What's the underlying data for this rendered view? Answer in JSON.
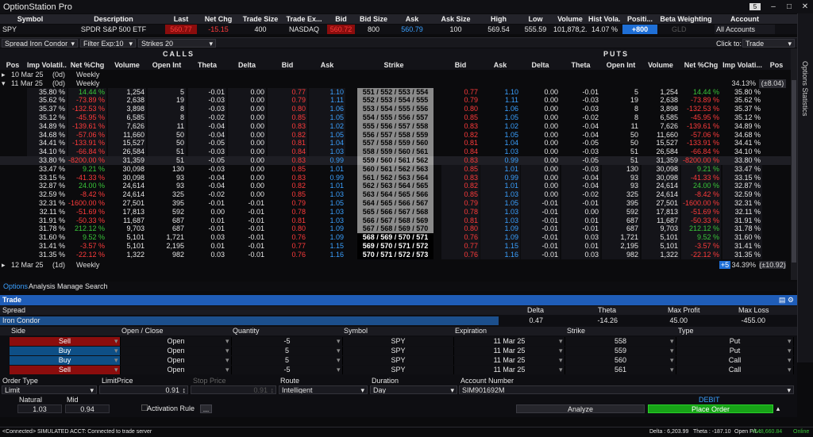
{
  "app": {
    "title": "OptionStation Pro",
    "notification_count": "5"
  },
  "quote": {
    "headers": [
      "Symbol",
      "Description",
      "Last",
      "Net Chg",
      "Trade Size",
      "Trade Ex...",
      "Bid",
      "Bid Size",
      "Ask",
      "Ask Size",
      "High",
      "Low",
      "Volume",
      "Hist Vola...",
      "Positi...",
      "Beta Weighting",
      "Account"
    ],
    "row": {
      "symbol": "SPY",
      "description": "SPDR S&P 500 ETF",
      "last": "560.77",
      "net_chg": "-15.15",
      "trade_size": "400",
      "trade_ex": "NASDAQ",
      "bid": "560.72",
      "bid_size": "800",
      "ask": "560.79",
      "ask_size": "100",
      "high": "569.54",
      "low": "555.59",
      "volume": "101,878,2...",
      "hist_vol": "14.07 %",
      "position": "+800",
      "beta": "GLD",
      "account": "All Accounts"
    }
  },
  "side_tab": "Options Statistics",
  "toolbar": {
    "spread_label": "Spread",
    "spread_value": "Iron Condor",
    "filter_label": "Filter",
    "filter_value": "Exp:10",
    "strikes_label": "Strikes",
    "strikes_value": "20",
    "click_to_label": "Click to:",
    "click_to_value": "Trade"
  },
  "chain": {
    "calls_label": "CALLS",
    "puts_label": "PUTS",
    "call_headers": [
      "Pos",
      "Imp Volatil...",
      "Net %Chg",
      "Volume",
      "Open Int",
      "Theta",
      "Delta",
      "Bid",
      "Ask"
    ],
    "strike_header": "Strike",
    "put_headers": [
      "Bid",
      "Ask",
      "Delta",
      "Theta",
      "Open Int",
      "Volume",
      "Net %Chg",
      "Imp Volati...",
      "Pos"
    ],
    "expiry_groups": [
      {
        "label": "10 Mar 25",
        "dte": "(0d)",
        "type": "Weekly"
      },
      {
        "label": "11 Mar 25",
        "dte": "(0d)",
        "type": "Weekly",
        "right_iv": "34.13%",
        "right_move": "(±8.04)"
      },
      {
        "label": "12 Mar 25",
        "dte": "(1d)",
        "type": "Weekly",
        "right_badge": "+5",
        "right_iv": "34.39%",
        "right_move": "(±10.92)"
      }
    ],
    "rows": [
      {
        "c_iv": "35.80 %",
        "c_pct": "14.44 %",
        "c_vol": "1,254",
        "c_oi": "5",
        "c_theta": "-0.01",
        "c_delta": "0.00",
        "c_bid": "0.77",
        "c_ask": "1.10",
        "strike": "551 / 552 / 553 / 554",
        "p_bid": "0.77",
        "p_ask": "1.10",
        "p_delta": "0.00",
        "p_theta": "-0.01",
        "p_oi": "5",
        "p_vol": "1,254",
        "p_pct": "14.44 %",
        "p_iv": "35.80 %"
      },
      {
        "c_iv": "35.62 %",
        "c_pct": "-73.89 %",
        "c_vol": "2,638",
        "c_oi": "19",
        "c_theta": "-0.03",
        "c_delta": "0.00",
        "c_bid": "0.79",
        "c_ask": "1.11",
        "strike": "552 / 553 / 554 / 555",
        "p_bid": "0.79",
        "p_ask": "1.11",
        "p_delta": "0.00",
        "p_theta": "-0.03",
        "p_oi": "19",
        "p_vol": "2,638",
        "p_pct": "-73.89 %",
        "p_iv": "35.62 %"
      },
      {
        "c_iv": "35.37 %",
        "c_pct": "-132.53 %",
        "c_vol": "3,898",
        "c_oi": "8",
        "c_theta": "-0.03",
        "c_delta": "0.00",
        "c_bid": "0.80",
        "c_ask": "1.06",
        "strike": "553 / 554 / 555 / 556",
        "p_bid": "0.80",
        "p_ask": "1.06",
        "p_delta": "0.00",
        "p_theta": "-0.03",
        "p_oi": "8",
        "p_vol": "3,898",
        "p_pct": "-132.53 %",
        "p_iv": "35.37 %"
      },
      {
        "c_iv": "35.12 %",
        "c_pct": "-45.95 %",
        "c_vol": "6,585",
        "c_oi": "8",
        "c_theta": "-0.02",
        "c_delta": "0.00",
        "c_bid": "0.85",
        "c_ask": "1.05",
        "strike": "554 / 555 / 556 / 557",
        "p_bid": "0.85",
        "p_ask": "1.05",
        "p_delta": "0.00",
        "p_theta": "-0.02",
        "p_oi": "8",
        "p_vol": "6,585",
        "p_pct": "-45.95 %",
        "p_iv": "35.12 %"
      },
      {
        "c_iv": "34.89 %",
        "c_pct": "-139.61 %",
        "c_vol": "7,626",
        "c_oi": "11",
        "c_theta": "-0.04",
        "c_delta": "0.00",
        "c_bid": "0.83",
        "c_ask": "1.02",
        "strike": "555 / 556 / 557 / 558",
        "p_bid": "0.83",
        "p_ask": "1.02",
        "p_delta": "0.00",
        "p_theta": "-0.04",
        "p_oi": "11",
        "p_vol": "7,626",
        "p_pct": "-139.61 %",
        "p_iv": "34.89 %"
      },
      {
        "c_iv": "34.68 %",
        "c_pct": "-57.06 %",
        "c_vol": "11,660",
        "c_oi": "50",
        "c_theta": "-0.04",
        "c_delta": "0.00",
        "c_bid": "0.82",
        "c_ask": "1.05",
        "strike": "556 / 557 / 558 / 559",
        "p_bid": "0.82",
        "p_ask": "1.05",
        "p_delta": "0.00",
        "p_theta": "-0.04",
        "p_oi": "50",
        "p_vol": "11,660",
        "p_pct": "-57.06 %",
        "p_iv": "34.68 %"
      },
      {
        "c_iv": "34.41 %",
        "c_pct": "-133.91 %",
        "c_vol": "15,527",
        "c_oi": "50",
        "c_theta": "-0.05",
        "c_delta": "0.00",
        "c_bid": "0.81",
        "c_ask": "1.04",
        "strike": "557 / 558 / 559 / 560",
        "p_bid": "0.81",
        "p_ask": "1.04",
        "p_delta": "0.00",
        "p_theta": "-0.05",
        "p_oi": "50",
        "p_vol": "15,527",
        "p_pct": "-133.91 %",
        "p_iv": "34.41 %"
      },
      {
        "c_iv": "34.10 %",
        "c_pct": "-66.84 %",
        "c_vol": "26,584",
        "c_oi": "51",
        "c_theta": "-0.03",
        "c_delta": "0.00",
        "c_bid": "0.84",
        "c_ask": "1.03",
        "strike": "558 / 559 / 560 / 561",
        "p_bid": "0.84",
        "p_ask": "1.03",
        "p_delta": "0.00",
        "p_theta": "-0.03",
        "p_oi": "51",
        "p_vol": "26,584",
        "p_pct": "-66.84 %",
        "p_iv": "34.10 %"
      },
      {
        "c_iv": "33.80 %",
        "c_pct": "-8200.00 %",
        "c_vol": "31,359",
        "c_oi": "51",
        "c_theta": "-0.05",
        "c_delta": "0.00",
        "c_bid": "0.83",
        "c_ask": "0.99",
        "strike": "559 / 560 / 561 / 562",
        "p_bid": "0.83",
        "p_ask": "0.99",
        "p_delta": "0.00",
        "p_theta": "-0.05",
        "p_oi": "51",
        "p_vol": "31,359",
        "p_pct": "-8200.00 %",
        "p_iv": "33.80 %"
      },
      {
        "c_iv": "33.47 %",
        "c_pct": "9.21 %",
        "c_vol": "30,098",
        "c_oi": "130",
        "c_theta": "-0.03",
        "c_delta": "0.00",
        "c_bid": "0.85",
        "c_ask": "1.01",
        "strike": "560 / 561 / 562 / 563",
        "p_bid": "0.85",
        "p_ask": "1.01",
        "p_delta": "0.00",
        "p_theta": "-0.03",
        "p_oi": "130",
        "p_vol": "30,098",
        "p_pct": "9.21 %",
        "p_iv": "33.47 %"
      },
      {
        "c_iv": "33.15 %",
        "c_pct": "-41.33 %",
        "c_vol": "30,098",
        "c_oi": "93",
        "c_theta": "-0.04",
        "c_delta": "0.00",
        "c_bid": "0.83",
        "c_ask": "0.99",
        "strike": "561 / 562 / 563 / 564",
        "p_bid": "0.83",
        "p_ask": "0.99",
        "p_delta": "0.00",
        "p_theta": "-0.04",
        "p_oi": "93",
        "p_vol": "30,098",
        "p_pct": "-41.33 %",
        "p_iv": "33.15 %"
      },
      {
        "c_iv": "32.87 %",
        "c_pct": "24.00 %",
        "c_vol": "24,614",
        "c_oi": "93",
        "c_theta": "-0.04",
        "c_delta": "0.00",
        "c_bid": "0.82",
        "c_ask": "1.01",
        "strike": "562 / 563 / 564 / 565",
        "p_bid": "0.82",
        "p_ask": "1.01",
        "p_delta": "0.00",
        "p_theta": "-0.04",
        "p_oi": "93",
        "p_vol": "24,614",
        "p_pct": "24.00 %",
        "p_iv": "32.87 %"
      },
      {
        "c_iv": "32.59 %",
        "c_pct": "-8.42 %",
        "c_vol": "24,614",
        "c_oi": "325",
        "c_theta": "-0.02",
        "c_delta": "0.00",
        "c_bid": "0.85",
        "c_ask": "1.03",
        "strike": "563 / 564 / 565 / 566",
        "p_bid": "0.85",
        "p_ask": "1.03",
        "p_delta": "0.00",
        "p_theta": "-0.02",
        "p_oi": "325",
        "p_vol": "24,614",
        "p_pct": "-8.42 %",
        "p_iv": "32.59 %"
      },
      {
        "c_iv": "32.31 %",
        "c_pct": "-1600.00 %",
        "c_vol": "27,501",
        "c_oi": "395",
        "c_theta": "-0.01",
        "c_delta": "-0.01",
        "c_bid": "0.79",
        "c_ask": "1.05",
        "strike": "564 / 565 / 566 / 567",
        "p_bid": "0.79",
        "p_ask": "1.05",
        "p_delta": "-0.01",
        "p_theta": "-0.01",
        "p_oi": "395",
        "p_vol": "27,501",
        "p_pct": "-1600.00 %",
        "p_iv": "32.31 %"
      },
      {
        "c_iv": "32.11 %",
        "c_pct": "-51.69 %",
        "c_vol": "17,813",
        "c_oi": "592",
        "c_theta": "0.00",
        "c_delta": "-0.01",
        "c_bid": "0.78",
        "c_ask": "1.03",
        "strike": "565 / 566 / 567 / 568",
        "p_bid": "0.78",
        "p_ask": "1.03",
        "p_delta": "-0.01",
        "p_theta": "0.00",
        "p_oi": "592",
        "p_vol": "17,813",
        "p_pct": "-51.69 %",
        "p_iv": "32.11 %"
      },
      {
        "c_iv": "31.91 %",
        "c_pct": "-50.33 %",
        "c_vol": "11,687",
        "c_oi": "687",
        "c_theta": "0.01",
        "c_delta": "-0.01",
        "c_bid": "0.81",
        "c_ask": "1.03",
        "strike": "566 / 567 / 568 / 569",
        "p_bid": "0.81",
        "p_ask": "1.03",
        "p_delta": "-0.01",
        "p_theta": "0.01",
        "p_oi": "687",
        "p_vol": "11,687",
        "p_pct": "-50.33 %",
        "p_iv": "31.91 %"
      },
      {
        "c_iv": "31.78 %",
        "c_pct": "212.12 %",
        "c_vol": "9,703",
        "c_oi": "687",
        "c_theta": "-0.01",
        "c_delta": "-0.01",
        "c_bid": "0.80",
        "c_ask": "1.09",
        "strike": "567 / 568 / 569 / 570",
        "p_bid": "0.80",
        "p_ask": "1.09",
        "p_delta": "-0.01",
        "p_theta": "-0.01",
        "p_oi": "687",
        "p_vol": "9,703",
        "p_pct": "212.12 %",
        "p_iv": "31.78 %"
      },
      {
        "c_iv": "31.60 %",
        "c_pct": "9.52 %",
        "c_vol": "5,101",
        "c_oi": "1,721",
        "c_theta": "0.03",
        "c_delta": "-0.01",
        "c_bid": "0.76",
        "c_ask": "1.09",
        "strike": "568 / 569 / 570 / 571",
        "p_bid": "0.76",
        "p_ask": "1.09",
        "p_delta": "-0.01",
        "p_theta": "0.03",
        "p_oi": "1,721",
        "p_vol": "5,101",
        "p_pct": "9.52 %",
        "p_iv": "31.60 %"
      },
      {
        "c_iv": "31.41 %",
        "c_pct": "-3.57 %",
        "c_vol": "5,101",
        "c_oi": "2,195",
        "c_theta": "0.01",
        "c_delta": "-0.01",
        "c_bid": "0.77",
        "c_ask": "1.15",
        "strike": "569 / 570 / 571 / 572",
        "p_bid": "0.77",
        "p_ask": "1.15",
        "p_delta": "-0.01",
        "p_theta": "0.01",
        "p_oi": "2,195",
        "p_vol": "5,101",
        "p_pct": "-3.57 %",
        "p_iv": "31.41 %"
      },
      {
        "c_iv": "31.35 %",
        "c_pct": "-22.12 %",
        "c_vol": "1,322",
        "c_oi": "982",
        "c_theta": "0.03",
        "c_delta": "-0.01",
        "c_bid": "0.76",
        "c_ask": "1.16",
        "strike": "570 / 571 / 572 / 573",
        "p_bid": "0.76",
        "p_ask": "1.16",
        "p_delta": "-0.01",
        "p_theta": "0.03",
        "p_oi": "982",
        "p_vol": "1,322",
        "p_pct": "-22.12 %",
        "p_iv": "31.35 %"
      }
    ]
  },
  "tabs": [
    "Options",
    "Analysis",
    "Manage",
    "Search"
  ],
  "trade": {
    "title": "Trade",
    "summary_labels": {
      "spread": "Spread",
      "delta": "Delta",
      "theta": "Theta",
      "max_profit": "Max Profit",
      "max_loss": "Max Loss"
    },
    "summary_values": {
      "spread": "Iron Condor",
      "delta": "0.47",
      "theta": "-14.26",
      "max_profit": "45.00",
      "max_loss": "-455.00"
    },
    "leg_headers": [
      "Side",
      "Open / Close",
      "Quantity",
      "Symbol",
      "Expiration",
      "Strike",
      "Type"
    ],
    "legs": [
      {
        "side": "Sell",
        "oc": "Open",
        "qty": "-5",
        "symbol": "SPY",
        "exp": "11 Mar 25",
        "strike": "558",
        "type": "Put"
      },
      {
        "side": "Buy",
        "oc": "Open",
        "qty": "5",
        "symbol": "SPY",
        "exp": "11 Mar 25",
        "strike": "559",
        "type": "Put"
      },
      {
        "side": "Buy",
        "oc": "Open",
        "qty": "5",
        "symbol": "SPY",
        "exp": "11 Mar 25",
        "strike": "560",
        "type": "Call"
      },
      {
        "side": "Sell",
        "oc": "Open",
        "qty": "-5",
        "symbol": "SPY",
        "exp": "11 Mar 25",
        "strike": "561",
        "type": "Call"
      }
    ],
    "order_labels": {
      "order_type": "Order Type",
      "limit_price": "LimitPrice",
      "stop_price": "Stop Price",
      "route": "Route",
      "duration": "Duration",
      "account": "Account Number"
    },
    "order_values": {
      "order_type": "Limit",
      "limit_price": "0.91",
      "stop_price": "0.91",
      "route": "Intelligent",
      "duration": "Day",
      "account": "SIM901692M"
    },
    "natural_label": "Natural",
    "natural_value": "1.03",
    "mid_label": "Mid",
    "mid_value": "0.94",
    "activation_label": "Activation Rule",
    "activation_btn": "...",
    "debit_label": "DEBIT",
    "analyze_label": "Analyze",
    "place_order_label": "Place Order"
  },
  "status": {
    "left": "<Connected> SIMULATED ACCT: Connected to trade server",
    "delta": "Delta : 6,203.99",
    "theta": "Theta : -187.10",
    "pl": "Open P/L :",
    "pl_value": "+548,660.84",
    "online": "Online"
  },
  "colors": {
    "positive": "#39c639",
    "negative": "#ff3b3b",
    "ask_blue": "#3aa0ff",
    "trade_header": "#1f5db8",
    "place_order": "#17a317",
    "sell_side": "#8b0d0d",
    "buy_side": "#0e4f86"
  }
}
